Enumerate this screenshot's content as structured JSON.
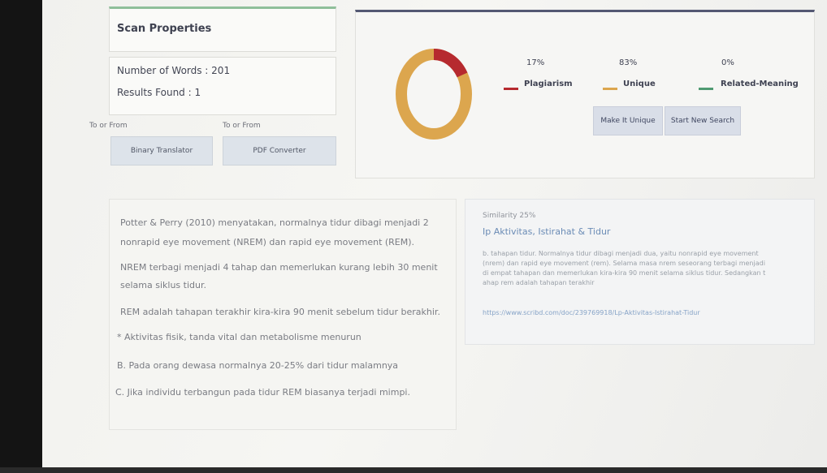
{
  "scan": {
    "title": "Scan Properties",
    "words": "Number of Words : 201",
    "results": "Results Found : 1"
  },
  "tools": [
    {
      "label": "To or From",
      "button": "Binary Translator"
    },
    {
      "label": "To or From",
      "button": "PDF Converter"
    }
  ],
  "result": {
    "stats": [
      {
        "name": "Plagiarism",
        "percent": "17%",
        "value": 17,
        "color": "#b62a2f"
      },
      {
        "name": "Unique",
        "percent": "83%",
        "value": 83,
        "color": "#dca64e"
      },
      {
        "name": "Related-Meaning",
        "percent": "0%",
        "value": 0,
        "color": "#4f9a72"
      }
    ],
    "buttons": {
      "unique": "Make It Unique",
      "new_search": "Start New Search"
    }
  },
  "content": {
    "paragraphs": [
      "Potter & Perry (2010) menyatakan, normalnya tidur dibagi menjadi 2",
      "nonrapid eye movement (NREM) dan rapid eye movement (REM).",
      "NREM terbagi menjadi 4 tahap dan memerlukan kurang lebih 30 menit",
      "selama siklus tidur.",
      "REM adalah tahapan terakhir kira-kira 90 menit sebelum tidur berakhir.",
      "* Aktivitas fisik, tanda vital dan metabolisme menurun",
      "B. Pada orang dewasa normalnya 20-25% dari tidur malamnya",
      "C. Jika individu terbangun pada tidur REM biasanya terjadi mimpi."
    ]
  },
  "match": {
    "similarity": "Similarity 25%",
    "title": "Ip Aktivitas, Istirahat & Tidur",
    "lines": [
      "b. tahapan tidur. Normalnya tidur dibagi menjadi dua, yaitu nonrapid eye movement",
      "(nrem) dan rapid eye movement (rem). Selama masa nrem seseorang terbagi menjadi",
      "di empat tahapan dan memerlukan kira-kira 90 menit selama siklus tidur. Sedangkan t",
      "ahap rem adalah tahapan terakhir"
    ],
    "url": "https://www.scribd.com/doc/239769918/Lp-Aktivitas-Istirahat-Tidur"
  }
}
